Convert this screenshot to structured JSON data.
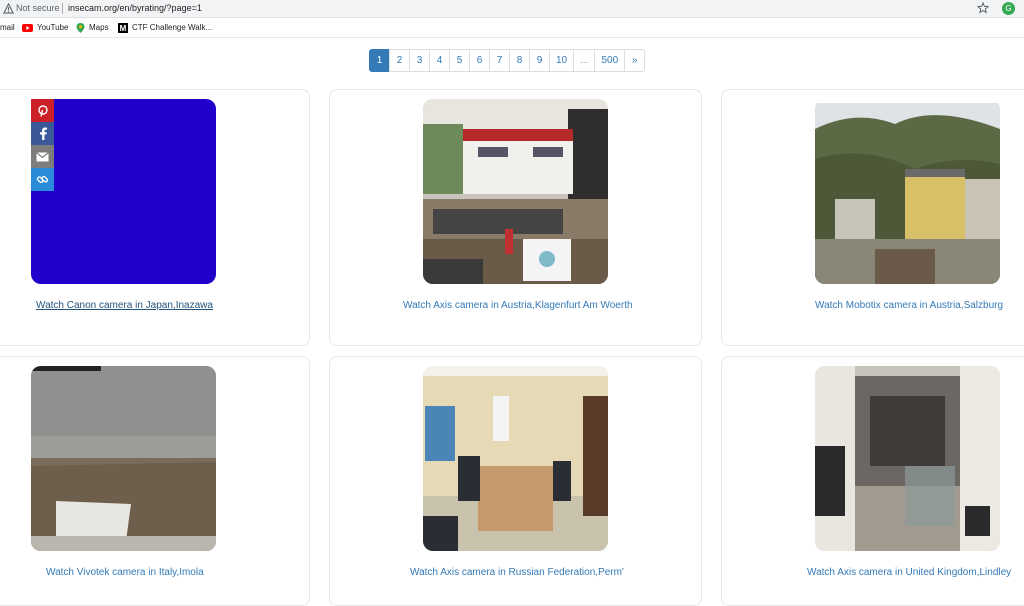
{
  "browser": {
    "security_label": "Not secure",
    "url": "insecam.org/en/byrating/?page=1",
    "profile_initial": "G"
  },
  "bookmarks": [
    {
      "label": "mail"
    },
    {
      "label": "YouTube"
    },
    {
      "label": "Maps"
    },
    {
      "label": "CTF Challenge Walk..."
    }
  ],
  "pagination": {
    "pages": [
      "1",
      "2",
      "3",
      "4",
      "5",
      "6",
      "7",
      "8",
      "9",
      "10",
      "...",
      "500",
      "»"
    ],
    "active": "1"
  },
  "share": {
    "buttons": [
      "pinterest",
      "facebook",
      "email",
      "link"
    ],
    "colors": {
      "pinterest": "#cb2027",
      "facebook": "#3b5998",
      "email": "#7d7d7d",
      "link": "#2a8cd9"
    }
  },
  "cameras": [
    {
      "caption": "Watch Canon camera in Japan,Inazawa"
    },
    {
      "caption": "Watch Axis camera in Austria,Klagenfurt Am Woerth"
    },
    {
      "caption": "Watch Mobotix camera in Austria,Salzburg"
    },
    {
      "caption": "Watch Vivotek camera in Italy,Imola"
    },
    {
      "caption": "Watch Axis camera in Russian Federation,Perm'"
    },
    {
      "caption": "Watch Axis camera in United Kingdom,Lindley"
    }
  ],
  "colors": {
    "link": "#337ab7",
    "active_page": "#337ab7",
    "blank_feed": "#2200cc"
  }
}
